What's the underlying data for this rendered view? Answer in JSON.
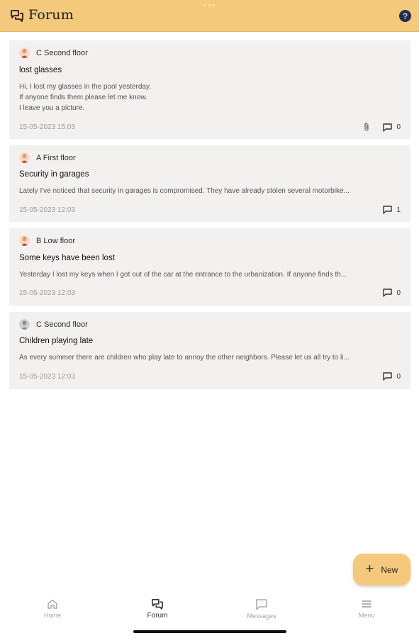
{
  "app": {
    "title": "Forum"
  },
  "posts": [
    {
      "author": "C Second floor",
      "title": "lost glasses",
      "body_lines": [
        "Hi, I lost my glasses in the pool yesterday.",
        "If anyone finds them please let me know.",
        "I leave you a picture."
      ],
      "date": "15-05-2023 15:03",
      "has_attachment": true,
      "comments": "0",
      "avatar": "person-avatar"
    },
    {
      "author": "A First floor",
      "title": "Security in garages",
      "body_lines": [
        "Lately I've noticed that security in garages is compromised. They have already stolen several motorbike..."
      ],
      "date": "15-05-2023 12:03",
      "has_attachment": false,
      "comments": "1",
      "avatar": "person-avatar"
    },
    {
      "author": "B Low floor",
      "title": "Some keys have been lost",
      "body_lines": [
        "Yesterday I lost my keys when I got out of the car at the entrance to the urbanization. If anyone finds th..."
      ],
      "date": "15-05-2023 12:03",
      "has_attachment": false,
      "comments": "0",
      "avatar": "person-avatar"
    },
    {
      "author": "C Second floor",
      "title": "Children playing late",
      "body_lines": [
        "As every summer there are children who play late to annoy the other neighbors. Please let us all try to li..."
      ],
      "date": "15-05-2023 12:03",
      "has_attachment": false,
      "comments": "0",
      "avatar": "default-avatar"
    }
  ],
  "fab": {
    "label": "New",
    "icon": "plus-icon"
  },
  "nav": [
    {
      "label": "Home",
      "icon": "home-icon",
      "active": false
    },
    {
      "label": "Forum",
      "icon": "forum-icon",
      "active": true
    },
    {
      "label": "Messages",
      "icon": "message-icon",
      "active": false
    },
    {
      "label": "Menu",
      "icon": "menu-icon",
      "active": false
    }
  ],
  "colors": {
    "accent": "#f4c97c",
    "card": "#f3f1f0",
    "help": "#1d2f57"
  }
}
